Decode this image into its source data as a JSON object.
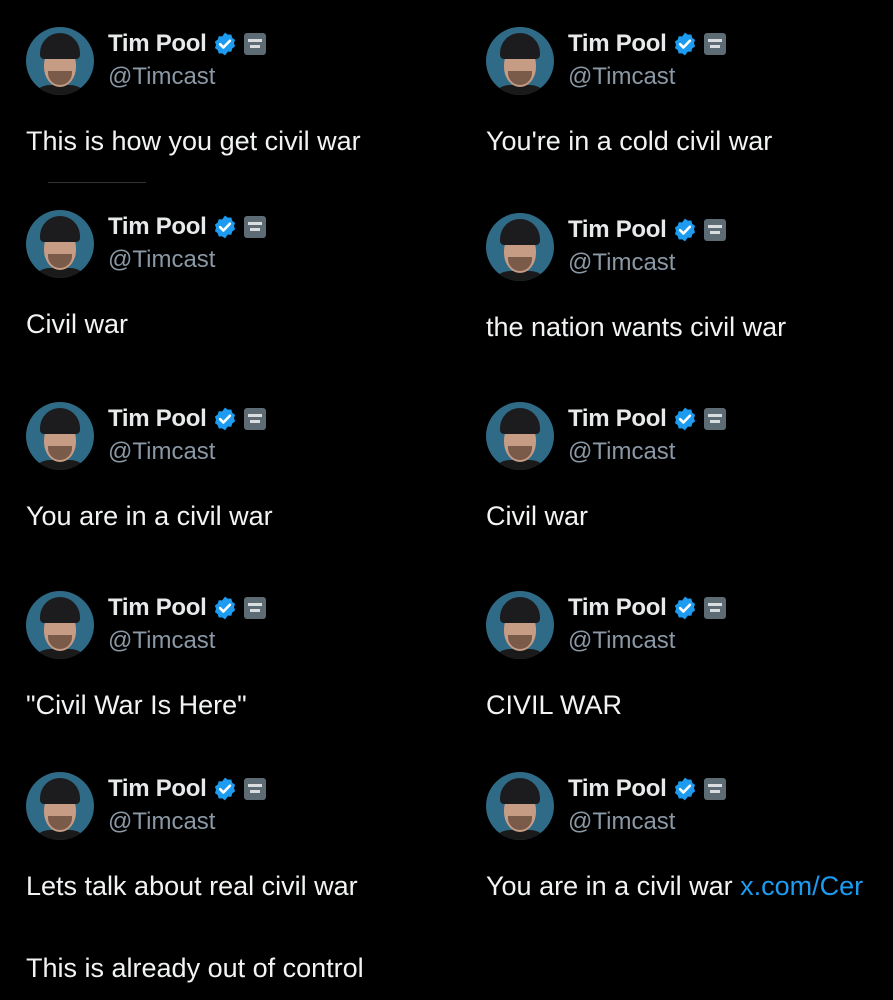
{
  "tweets": [
    {
      "name": "Tim Pool",
      "handle": "@Timcast",
      "text": "This is how you get civil war"
    },
    {
      "name": "Tim Pool",
      "handle": "@Timcast",
      "text": "You're in a cold civil war"
    },
    {
      "name": "Tim Pool",
      "handle": "@Timcast",
      "text": "Civil war"
    },
    {
      "name": "Tim Pool",
      "handle": "@Timcast",
      "text": "the nation wants civil war"
    },
    {
      "name": "Tim Pool",
      "handle": "@Timcast",
      "text": "You are in a civil war"
    },
    {
      "name": "Tim Pool",
      "handle": "@Timcast",
      "text": "Civil war"
    },
    {
      "name": "Tim Pool",
      "handle": "@Timcast",
      "text": "\"Civil War Is Here\""
    },
    {
      "name": "Tim Pool",
      "handle": "@Timcast",
      "text": "CIVIL WAR"
    },
    {
      "name": "Tim Pool",
      "handle": "@Timcast",
      "text": "Lets talk about real civil war",
      "text2": "This is already out of control"
    },
    {
      "name": "Tim Pool",
      "handle": "@Timcast",
      "text": "You are in a civil war ",
      "link": "x.com/Cer"
    }
  ],
  "colors": {
    "background": "#000000",
    "text": "#e7e9ea",
    "handle": "#8b98a5",
    "verified": "#1d9bf0",
    "link": "#1d9bf0"
  },
  "icons": {
    "verified": "verified-badge-icon",
    "affiliation": "timcast-affiliate-badge-icon"
  }
}
